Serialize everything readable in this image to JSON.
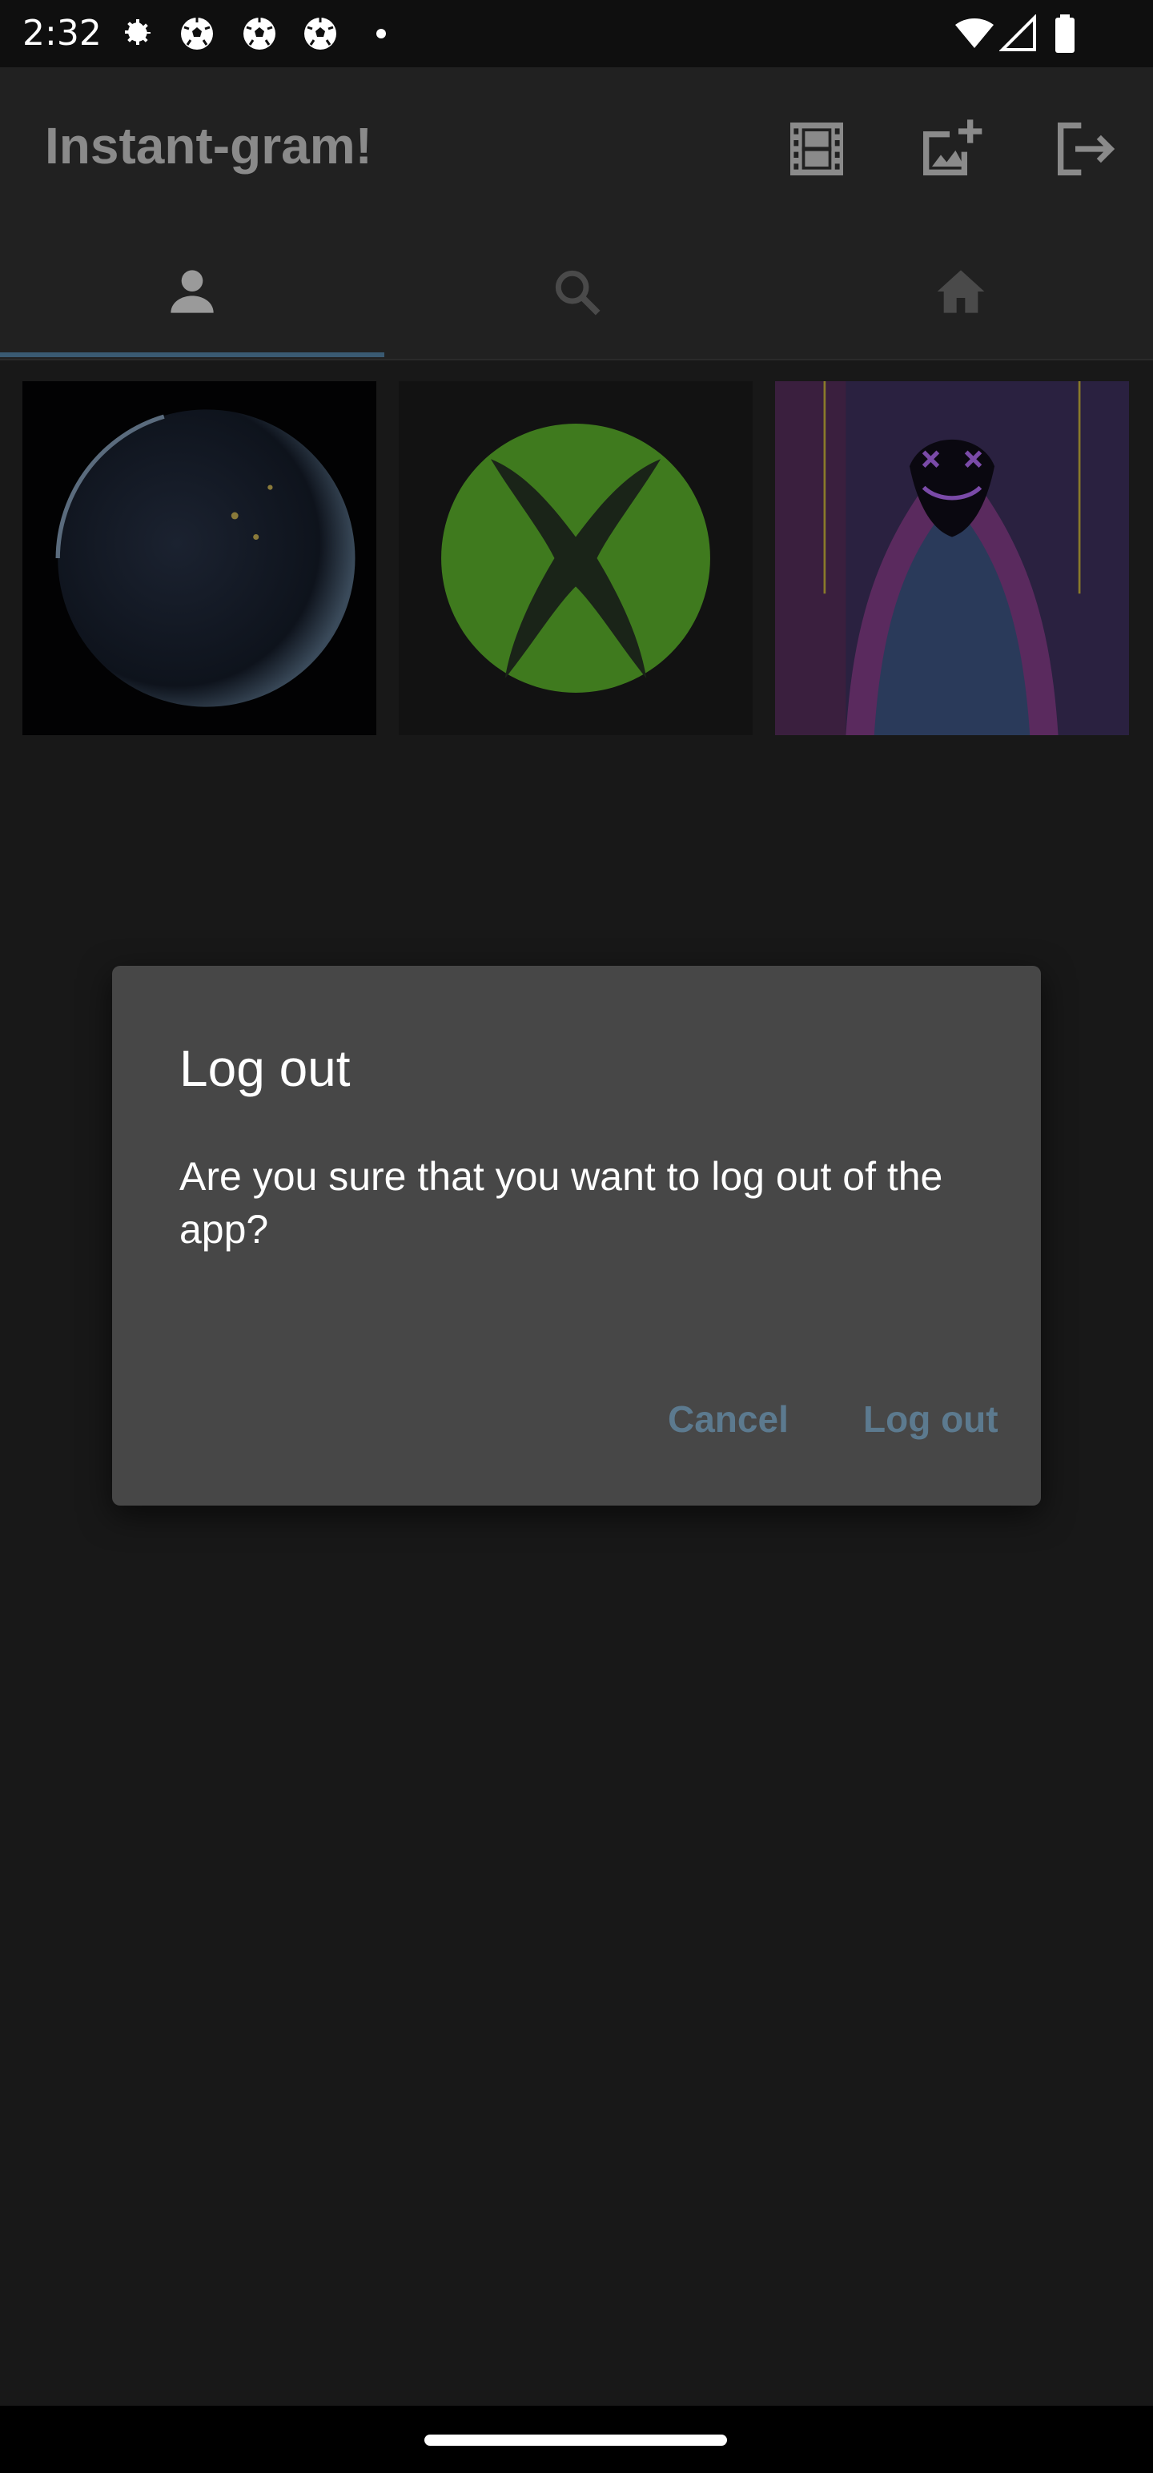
{
  "status_bar": {
    "time": "2:32",
    "icons": [
      "settings-icon",
      "soccer-ball-icon",
      "soccer-ball-icon",
      "soccer-ball-icon",
      "dot-icon",
      "wifi-icon",
      "signal-icon",
      "battery-icon"
    ]
  },
  "app_bar": {
    "title": "Instant-gram!",
    "actions": [
      "film-icon",
      "add-photo-icon",
      "logout-icon"
    ]
  },
  "tabs": {
    "items": [
      "person-icon",
      "search-icon",
      "home-icon"
    ],
    "selected_index": 0
  },
  "grid": {
    "images": [
      "earth-at-night",
      "xbox-logo",
      "neon-hooded-figure"
    ]
  },
  "dialog": {
    "title": "Log out",
    "message": "Are you sure that you want to log out of the app?",
    "cancel_label": "Cancel",
    "confirm_label": "Log out"
  },
  "colors": {
    "background": "#181818",
    "app_bar": "#212121",
    "dialog": "#474747",
    "button_text": "#5c7a8f",
    "tab_indicator": "#3a5a72"
  }
}
